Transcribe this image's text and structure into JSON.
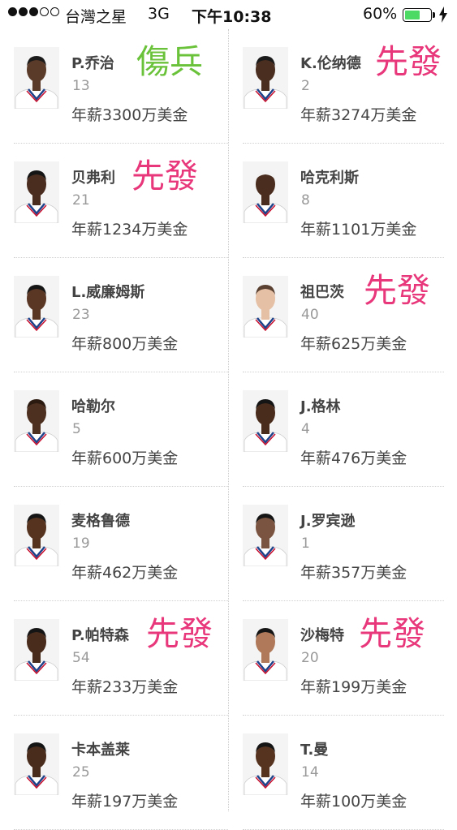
{
  "status_bar": {
    "carrier": "台灣之星",
    "network": "3G",
    "time": "下午10:38",
    "battery_percent": "60%",
    "battery_level": 0.6,
    "signal_strength": 3,
    "signal_max": 5
  },
  "colors": {
    "starter_tag": "#e8377a",
    "injured_tag": "#6ac23a",
    "battery_fill": "#4cd964",
    "name_text": "#444444",
    "number_text": "#999999"
  },
  "players": [
    {
      "name": "P.乔治",
      "number": "13",
      "salary": "年薪3300万美金",
      "tag": "傷兵",
      "tag_type": "injured",
      "skin": "#5a3a28",
      "hair": "#1a1a1a"
    },
    {
      "name": "K.伦纳德",
      "number": "2",
      "salary": "年薪3274万美金",
      "tag": "先發",
      "tag_type": "starter",
      "skin": "#4a2e20",
      "hair": "#1a1a1a"
    },
    {
      "name": "贝弗利",
      "number": "21",
      "salary": "年薪1234万美金",
      "tag": "先發",
      "tag_type": "starter",
      "skin": "#4b2d1f",
      "hair": "#151515"
    },
    {
      "name": "哈克利斯",
      "number": "8",
      "salary": "年薪1101万美金",
      "tag": "",
      "tag_type": "",
      "skin": "#4a2d1e",
      "hair": "#f2f2f2"
    },
    {
      "name": "L.威廉姆斯",
      "number": "23",
      "salary": "年薪800万美金",
      "tag": "",
      "tag_type": "",
      "skin": "#5a3625",
      "hair": "#151515"
    },
    {
      "name": "祖巴茨",
      "number": "40",
      "salary": "年薪625万美金",
      "tag": "先發",
      "tag_type": "starter",
      "skin": "#e6c0a4",
      "hair": "#5a4030"
    },
    {
      "name": "哈勒尔",
      "number": "5",
      "salary": "年薪600万美金",
      "tag": "",
      "tag_type": "",
      "skin": "#4e3020",
      "hair": "#2a1a10"
    },
    {
      "name": "J.格林",
      "number": "4",
      "salary": "年薪476万美金",
      "tag": "",
      "tag_type": "",
      "skin": "#4a2c1c",
      "hair": "#151515"
    },
    {
      "name": "麦格鲁德",
      "number": "19",
      "salary": "年薪462万美金",
      "tag": "",
      "tag_type": "",
      "skin": "#55331f",
      "hair": "#151515"
    },
    {
      "name": "J.罗宾逊",
      "number": "1",
      "salary": "年薪357万美金",
      "tag": "",
      "tag_type": "",
      "skin": "#7a5440",
      "hair": "#151515"
    },
    {
      "name": "P.帕特森",
      "number": "54",
      "salary": "年薪233万美金",
      "tag": "先發",
      "tag_type": "starter",
      "skin": "#4a2c1c",
      "hair": "#151515"
    },
    {
      "name": "沙梅特",
      "number": "20",
      "salary": "年薪199万美金",
      "tag": "先發",
      "tag_type": "starter",
      "skin": "#b07a5a",
      "hair": "#151515"
    },
    {
      "name": "卡本盖莱",
      "number": "25",
      "salary": "年薪197万美金",
      "tag": "",
      "tag_type": "",
      "skin": "#4a2c1c",
      "hair": "#151515"
    },
    {
      "name": "T.曼",
      "number": "14",
      "salary": "年薪100万美金",
      "tag": "",
      "tag_type": "",
      "skin": "#55331f",
      "hair": "#151515"
    }
  ]
}
